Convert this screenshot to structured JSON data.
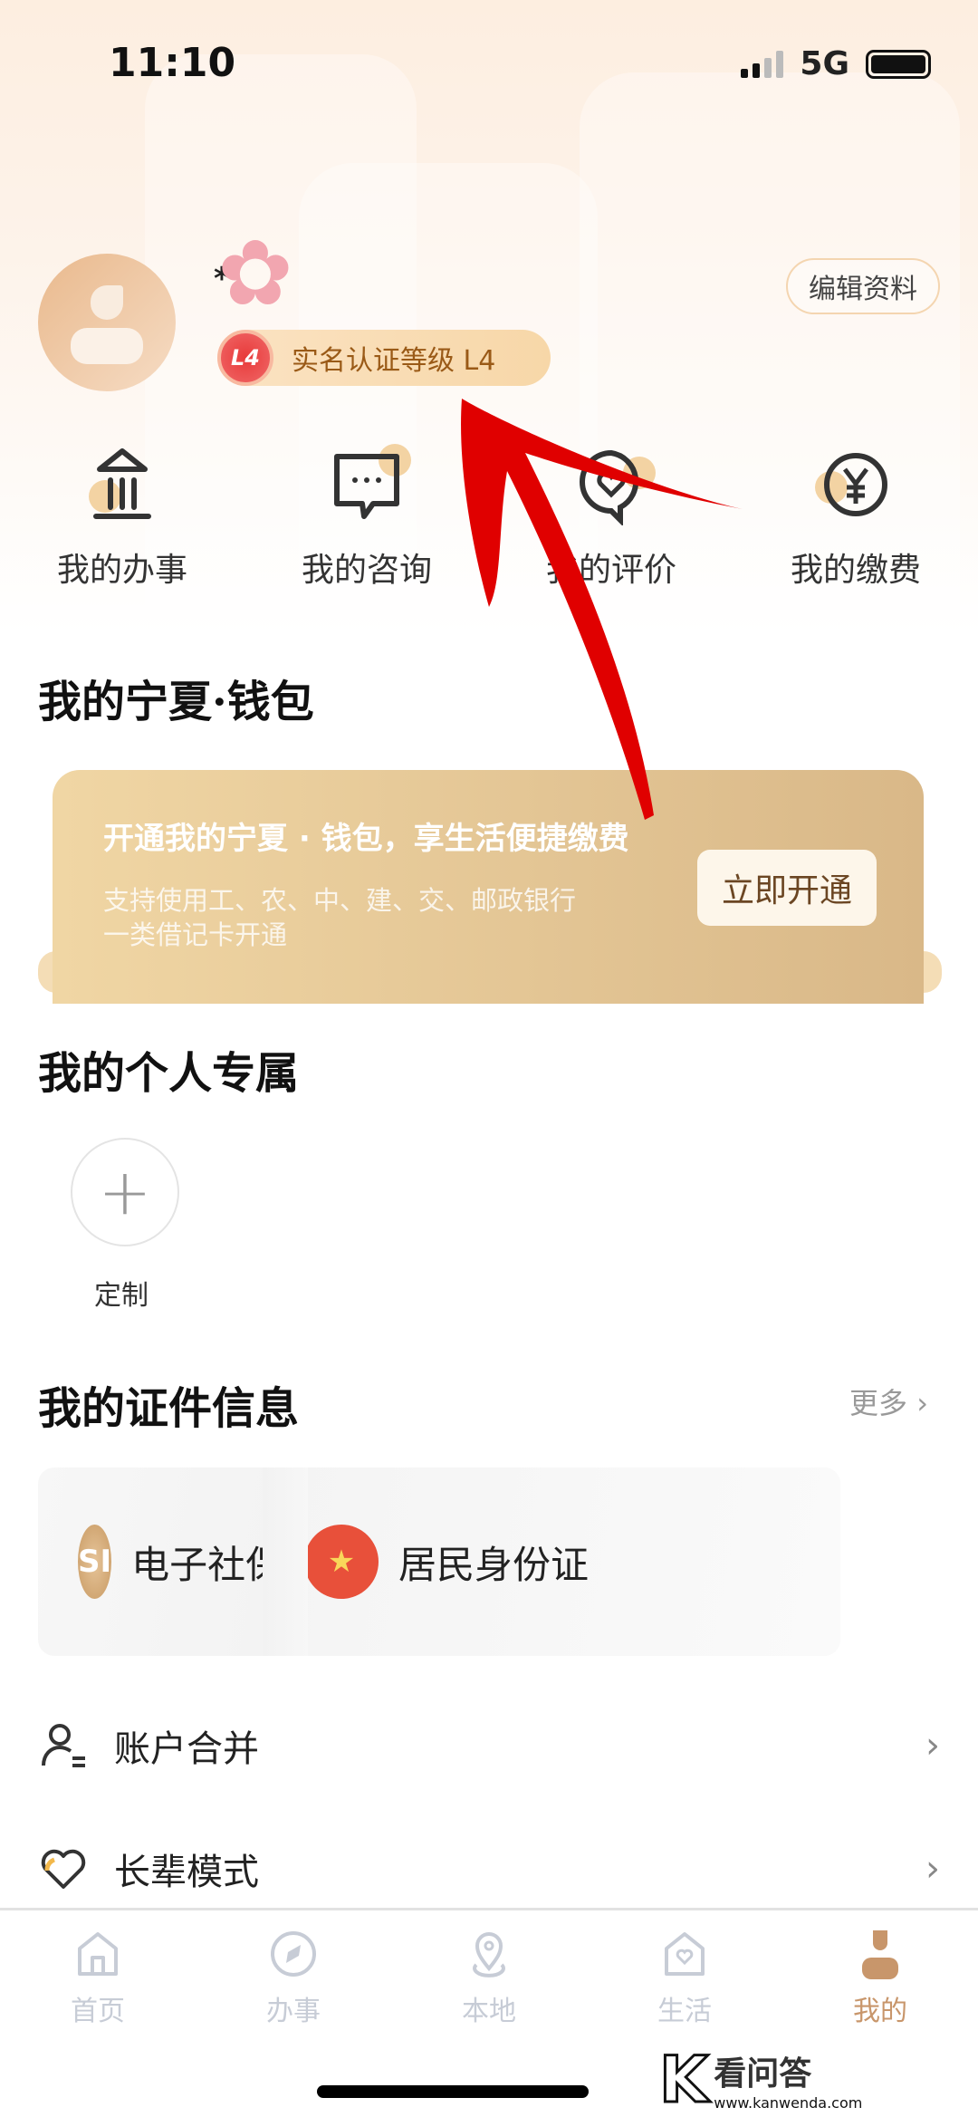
{
  "status_bar": {
    "time": "11:10",
    "network": "5G",
    "battery_level": 1.0
  },
  "profile": {
    "name_prefix": "*",
    "verify_badge_icon": "L4",
    "verify_level_label": "实名认证等级 L4",
    "edit_button": "编辑资料"
  },
  "quick_actions": [
    {
      "label": "我的办事",
      "icon": "bank-icon"
    },
    {
      "label": "我的咨询",
      "icon": "chat-icon"
    },
    {
      "label": "我的评价",
      "icon": "review-icon"
    },
    {
      "label": "我的缴费",
      "icon": "yen-icon"
    }
  ],
  "wallet": {
    "section_title": "我的宁夏·钱包",
    "banner_title": "开通我的宁夏 · 钱包，享生活便捷缴费",
    "banner_subtitle_line1": "支持使用工、农、中、建、交、邮政银行",
    "banner_subtitle_line2": "一类借记卡开通",
    "open_button": "立即开通"
  },
  "personal": {
    "section_title": "我的个人专属",
    "custom_label": "定制"
  },
  "certificates": {
    "section_title": "我的证件信息",
    "more_label": "更多",
    "cards": [
      {
        "icon_text": "SI",
        "label": "电子社保卡"
      },
      {
        "icon_text": "★",
        "label": "居民身份证"
      }
    ]
  },
  "menu": [
    {
      "label": "账户合并",
      "icon": "user-merge-icon"
    },
    {
      "label": "长辈模式",
      "icon": "heart-icon"
    }
  ],
  "tabbar": {
    "active": "我的",
    "items": [
      {
        "label": "首页"
      },
      {
        "label": "办事"
      },
      {
        "label": "本地"
      },
      {
        "label": "生活"
      },
      {
        "label": "我的"
      }
    ]
  },
  "watermark": {
    "brand": "看问答",
    "url": "www.kanwenda.com"
  },
  "colors": {
    "accent": "#c8966b",
    "banner": "#d9b888",
    "annotation_arrow": "#e00000"
  }
}
